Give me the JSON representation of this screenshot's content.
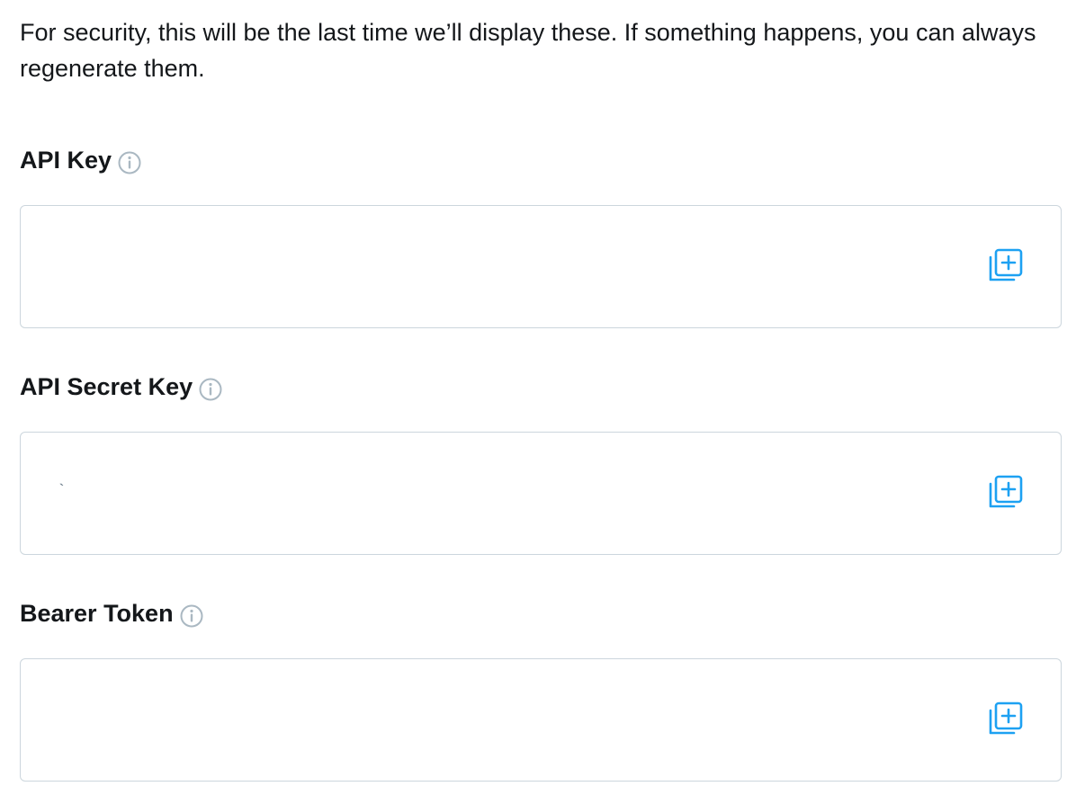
{
  "intro_text": "For security, this will be the last time we’ll display these. If something happens, you can always regenerate them.",
  "fields": [
    {
      "label": "API Key",
      "value": ""
    },
    {
      "label": "API Secret Key",
      "value": "`"
    },
    {
      "label": "Bearer Token",
      "value": ""
    }
  ],
  "icons": {
    "info": "info-circle-icon",
    "copy": "copy-icon"
  },
  "colors": {
    "text": "#14171a",
    "border": "#ccd6dd",
    "info_icon": "#aab8c2",
    "copy_icon": "#1da1f2"
  }
}
